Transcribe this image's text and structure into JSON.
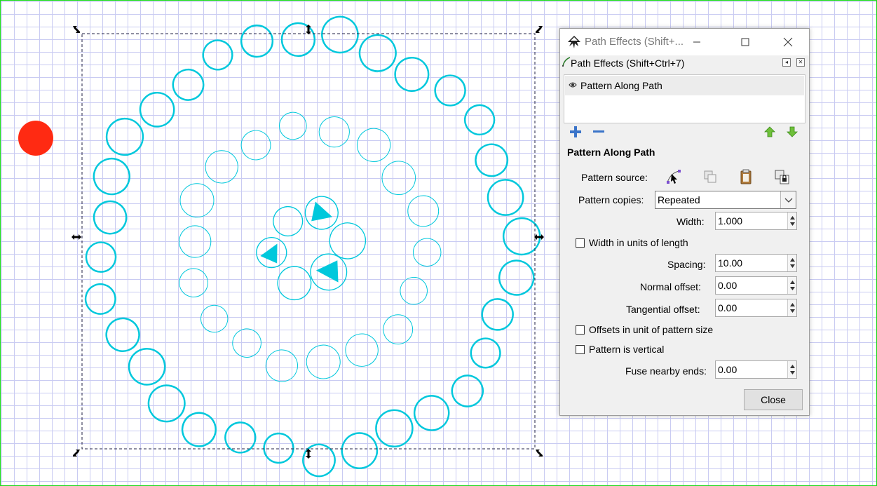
{
  "canvas": {
    "grid_color": "#c9cbf2",
    "page_border_color": "#17d817",
    "selection_color": "#222244",
    "object": {
      "name": "Pattern Along Path",
      "color": "#00c8dc",
      "rings": [
        {
          "label": "outer",
          "count": 32
        },
        {
          "label": "middle",
          "count": 18
        },
        {
          "label": "inner",
          "count": 6
        }
      ]
    },
    "red_dot_color": "#ff2a12"
  },
  "dialog": {
    "window_title": "Path Effects  (Shift+...",
    "dock_title": "Path Effects  (Shift+Ctrl+7)",
    "effects": [
      {
        "label": "Pattern Along Path",
        "visible": true
      }
    ],
    "list_buttons": {
      "add_icon": "plus-icon",
      "remove_icon": "minus-icon",
      "up_icon": "arrow-up-icon",
      "down_icon": "arrow-down-icon"
    },
    "section_title": "Pattern Along Path",
    "pattern_source_label": "Pattern source:",
    "pattern_copies_label": "Pattern copies:",
    "pattern_copies_value": "Repeated",
    "width_label": "Width:",
    "width_value": "1.000",
    "width_units_label": "Width in units of length",
    "spacing_label": "Spacing:",
    "spacing_value": "10.00",
    "normal_offset_label": "Normal offset:",
    "normal_offset_value": "0.00",
    "tangential_offset_label": "Tangential offset:",
    "tangential_offset_value": "0.00",
    "offsets_unit_label": "Offsets in unit of pattern size",
    "pattern_vertical_label": "Pattern is vertical",
    "fuse_label": "Fuse nearby ends:",
    "fuse_value": "0.00",
    "close_label": "Close"
  }
}
